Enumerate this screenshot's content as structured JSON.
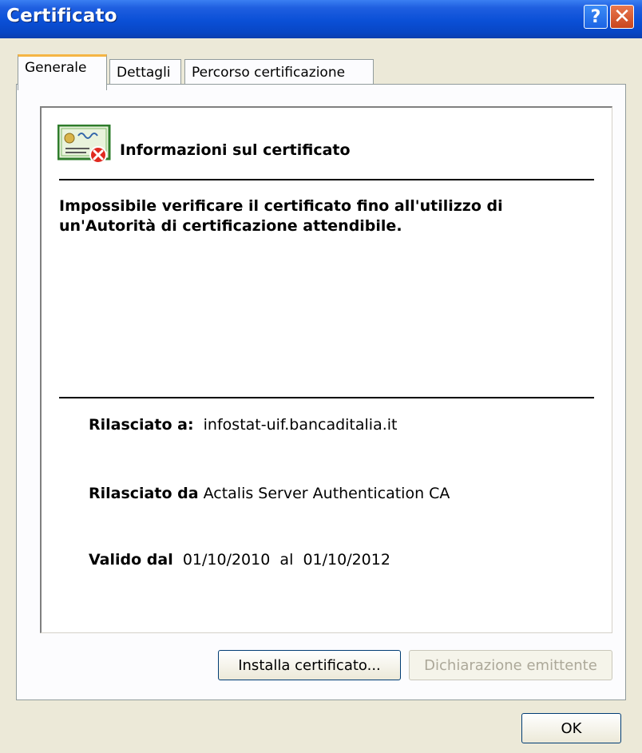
{
  "window": {
    "title": "Certificato",
    "help_label": "?",
    "close_label": "✕"
  },
  "tabs": [
    {
      "label": "Generale"
    },
    {
      "label": "Dettagli"
    },
    {
      "label": "Percorso certificazione"
    }
  ],
  "info": {
    "title": "Informazioni sul certificato",
    "error_line1": "Impossibile verificare il certificato fino all'utilizzo di",
    "error_line2": "un'Autorità di certificazione attendibile."
  },
  "fields": {
    "issued_to_label": "Rilasciato a:",
    "issued_to_value": "infostat-uif.bancaditalia.it",
    "issued_by_label": "Rilasciato da",
    "issued_by_value": "Actalis Server Authentication CA",
    "valid_label": "Valido dal",
    "valid_from": "01/10/2010",
    "valid_sep": "al",
    "valid_to": "01/10/2012"
  },
  "buttons": {
    "install": "Installa certificato...",
    "issuer_statement": "Dichiarazione emittente",
    "ok": "OK"
  },
  "icons": {
    "certificate": "certificate-error-icon"
  }
}
